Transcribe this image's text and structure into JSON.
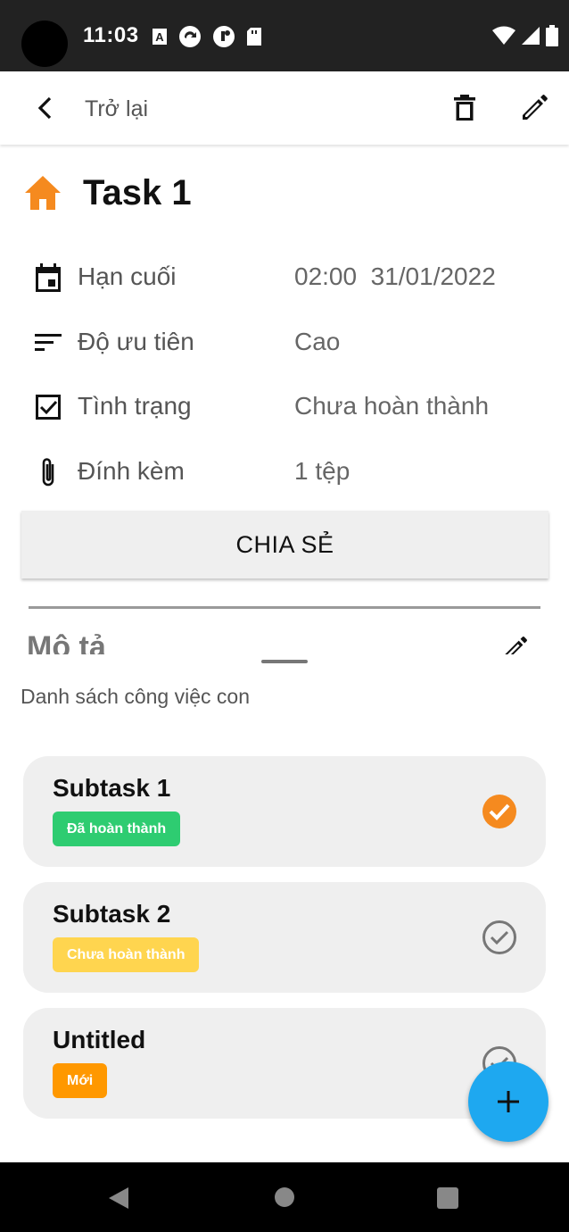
{
  "status_bar": {
    "time": "11:03",
    "left_icons": [
      "font-a-icon",
      "sync-icon",
      "app-icon",
      "sd-card-icon"
    ],
    "right_icons": [
      "wifi-icon",
      "cell-signal-icon",
      "battery-icon"
    ]
  },
  "app_bar": {
    "back_label": "Trở lại",
    "actions": [
      "delete-icon",
      "edit-icon"
    ]
  },
  "task": {
    "title": "Task 1",
    "icon": "home-icon",
    "icon_color": "#f58a1f",
    "details": [
      {
        "icon": "calendar-icon",
        "label": "Hạn cuối",
        "value": "02:00  31/01/2022"
      },
      {
        "icon": "sort-icon",
        "label": "Độ ưu tiên",
        "value": "Cao"
      },
      {
        "icon": "checkbox-icon",
        "label": "Tình trạng",
        "value": "Chưa hoàn thành"
      },
      {
        "icon": "paperclip-icon",
        "label": "Đính kèm",
        "value": "1 tệp"
      }
    ]
  },
  "share_button": {
    "label": "CHIA SẺ"
  },
  "description": {
    "title": "Mô tả"
  },
  "subtasks": {
    "title": "Danh sách công việc con",
    "items": [
      {
        "name": "Subtask 1",
        "status": "Đã hoàn thành",
        "status_color": "#2ecc71",
        "checked": true
      },
      {
        "name": "Subtask 2",
        "status": "Chưa hoàn thành",
        "status_color": "#ffd54f",
        "checked": false
      },
      {
        "name": "Untitled",
        "status": "Mới",
        "status_color": "#ff9800",
        "checked": false
      }
    ]
  },
  "colors": {
    "accent": "#f58a1f",
    "fab": "#1ea8f0",
    "card_bg": "#efefef"
  },
  "fab": {
    "icon": "plus-icon"
  },
  "nav_bar": {
    "buttons": [
      "back-triangle-icon",
      "home-circle-icon",
      "recents-square-icon"
    ]
  }
}
